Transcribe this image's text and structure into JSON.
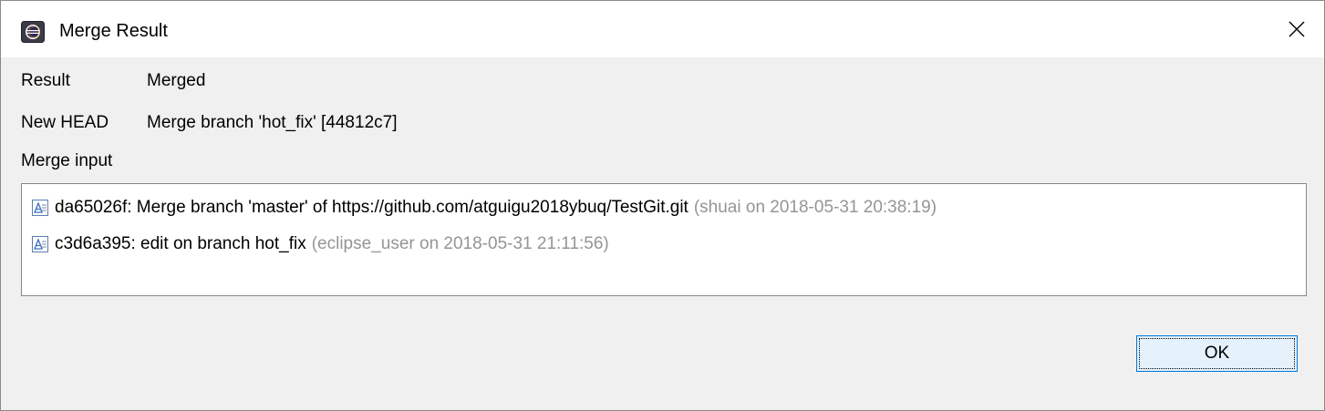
{
  "window": {
    "title": "Merge Result",
    "app_icon": "eclipse-icon",
    "close_icon": "close-icon"
  },
  "fields": {
    "result_label": "Result",
    "result_value": "Merged",
    "new_head_label": "New HEAD",
    "new_head_value": "Merge branch 'hot_fix' [44812c7]",
    "merge_input_label": "Merge input"
  },
  "merge_inputs": [
    {
      "icon": "commit-icon",
      "text": "da65026f: Merge branch 'master' of https://github.com/atguigu2018ybuq/TestGit.git",
      "meta": "(shuai on 2018-05-31 20:38:19)"
    },
    {
      "icon": "commit-icon",
      "text": "c3d6a395: edit on branch hot_fix",
      "meta": "(eclipse_user on 2018-05-31 21:11:56)"
    }
  ],
  "buttons": {
    "ok_label": "OK"
  },
  "colors": {
    "dialog_background": "#f0f0f0",
    "title_background": "#ffffff",
    "meta_text": "#959595",
    "button_border_focus": "#0078d7",
    "button_background": "#e5f1fb"
  }
}
